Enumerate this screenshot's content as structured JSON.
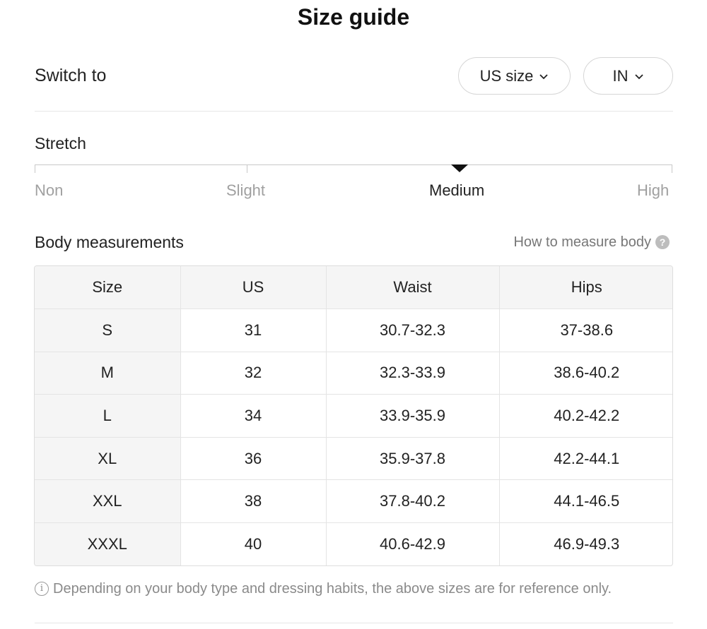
{
  "title": "Size guide",
  "switch": {
    "label": "Switch to",
    "size_system": "US size",
    "unit": "IN"
  },
  "stretch": {
    "label": "Stretch",
    "levels": [
      "Non",
      "Slight",
      "Medium",
      "High"
    ],
    "selected": "Medium"
  },
  "body": {
    "label": "Body measurements",
    "how_to": "How to measure body",
    "help_icon": "question-circle-icon"
  },
  "table": {
    "headers": [
      "Size",
      "US",
      "Waist",
      "Hips"
    ],
    "rows": [
      [
        "S",
        "31",
        "30.7-32.3",
        "37-38.6"
      ],
      [
        "M",
        "32",
        "32.3-33.9",
        "38.6-40.2"
      ],
      [
        "L",
        "34",
        "33.9-35.9",
        "40.2-42.2"
      ],
      [
        "XL",
        "36",
        "35.9-37.8",
        "42.2-44.1"
      ],
      [
        "XXL",
        "38",
        "37.8-40.2",
        "44.1-46.5"
      ],
      [
        "XXXL",
        "40",
        "40.6-42.9",
        "46.9-49.3"
      ]
    ]
  },
  "note": {
    "icon": "info-circle-icon",
    "text": "Depending on your body type and dressing habits, the above sizes are for reference only."
  }
}
